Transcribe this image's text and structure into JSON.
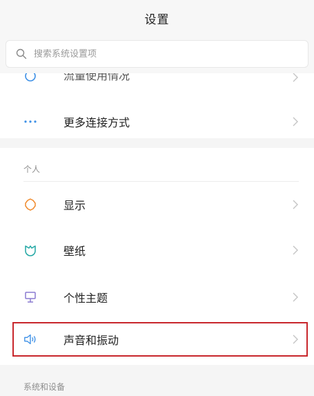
{
  "header": {
    "title": "设置"
  },
  "search": {
    "placeholder": "搜索系统设置项"
  },
  "network": {
    "partial_item": "流量使用情况",
    "more_connections": "更多连接方式"
  },
  "personal": {
    "section_title": "个人",
    "items": [
      {
        "label": "显示",
        "icon": "brightness-icon"
      },
      {
        "label": "壁纸",
        "icon": "wallpaper-icon"
      },
      {
        "label": "个性主题",
        "icon": "theme-icon"
      },
      {
        "label": "声音和振动",
        "icon": "speaker-icon"
      }
    ]
  },
  "system": {
    "section_title": "系统和设备"
  },
  "colors": {
    "accent_blue": "#3b8fe6",
    "orange": "#f08a2c",
    "teal": "#1fa6a3",
    "purple": "#8a7ad1",
    "highlight": "#c8262b"
  }
}
